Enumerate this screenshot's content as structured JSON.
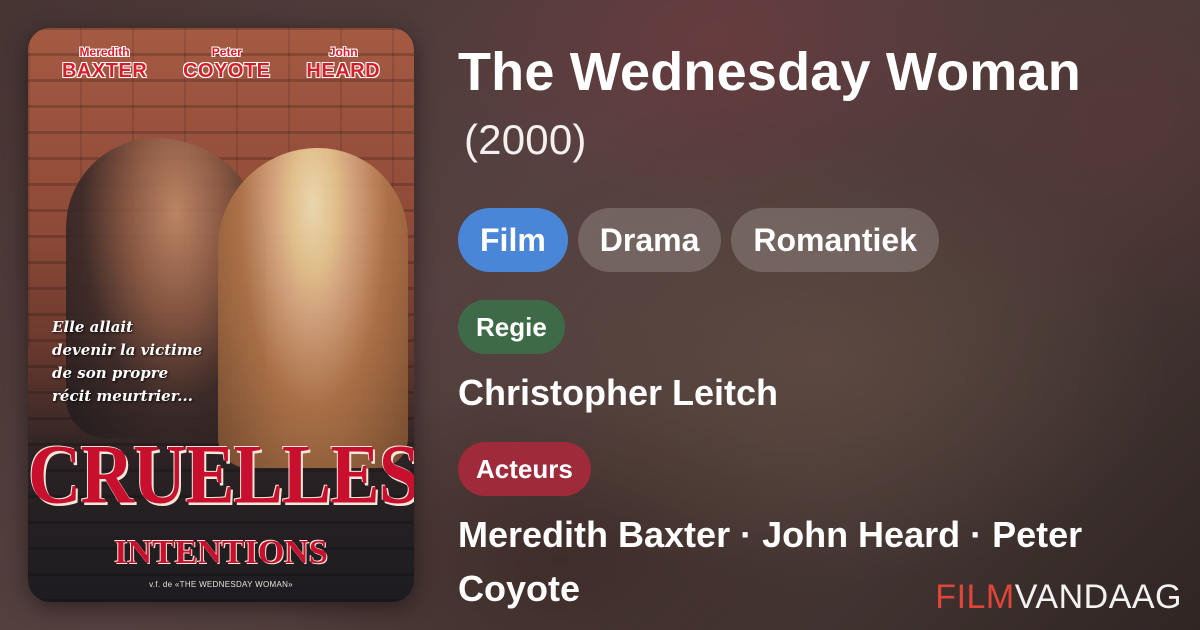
{
  "movie": {
    "title": "The Wednesday Woman",
    "year": "(2000)"
  },
  "tags": [
    {
      "label": "Film",
      "color": "#4a86d8"
    },
    {
      "label": "Drama"
    },
    {
      "label": "Romantiek"
    }
  ],
  "regie": {
    "label": "Regie",
    "label_color": "#3e6a48",
    "value": "Christopher Leitch"
  },
  "acteurs": {
    "label": "Acteurs",
    "label_color": "#9e2a3a",
    "value": "Meredith Baxter · John Heard · Peter Coyote"
  },
  "poster": {
    "cast": [
      {
        "first": "Meredith",
        "last": "BAXTER"
      },
      {
        "first": "Peter",
        "last": "COYOTE"
      },
      {
        "first": "John",
        "last": "HEARD"
      }
    ],
    "tagline": "Elle allait\ndevenir la victime\nde son propre\nrécit meurtrier...",
    "title": "CRUELLES",
    "subtitle": "INTENTIONS",
    "credit": "v.f. de «THE WEDNESDAY WOMAN»"
  },
  "brand": {
    "part1": "FILM",
    "part2": "VANDAAG",
    "accent_color": "#e0453a"
  }
}
